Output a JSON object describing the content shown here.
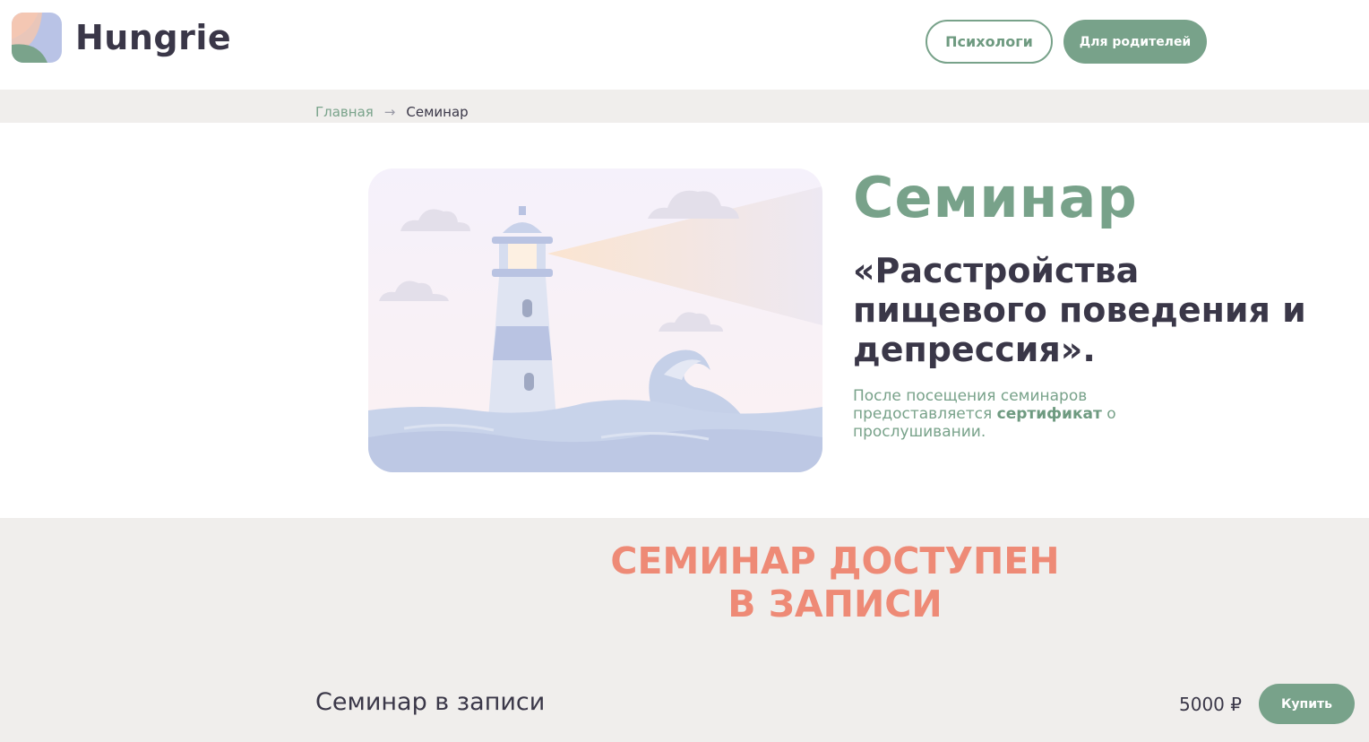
{
  "header": {
    "brand": "Hungrie",
    "psychologists_label": "Психологи",
    "parents_label": "Для родителей"
  },
  "breadcrumb": {
    "home": "Главная",
    "current": "Семинар"
  },
  "hero": {
    "title": "Семинар",
    "subtitle": "«Расстройства пищевого поведения и депрессия».",
    "note_part1": "После посещения семинаров предоставляется ",
    "note_bold": "сертификат",
    "note_part2": " о прослушивании."
  },
  "offer": {
    "available_line1": "СЕМИНАР ДОСТУПЕН",
    "available_line2": "В ЗАПИСИ",
    "item_name": "Семинар в записи",
    "price": "5000 ₽",
    "buy_label": "Купить"
  },
  "colors": {
    "accent_green": "#78a28a",
    "text_dark": "#3a3748",
    "coral": "#ee8a76",
    "band_gray": "#f0eeec"
  },
  "icons": {
    "logo": "hungrie-logo-icon",
    "breadcrumb_separator": "arrow-right-icon",
    "hero_image": "lighthouse-illustration"
  }
}
